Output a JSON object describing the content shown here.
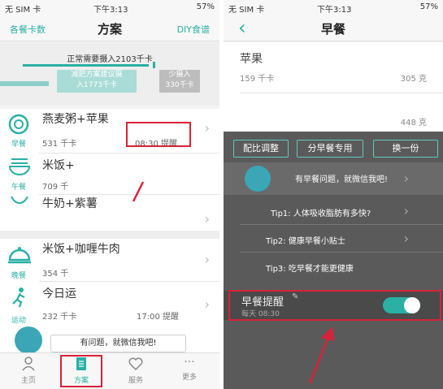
{
  "left": {
    "status": {
      "carrier": "无 SIM 卡",
      "time": "下午3:13",
      "battery": "57%"
    },
    "nav": {
      "left": "各餐卡数",
      "title": "方案",
      "right": "DIY食谱"
    },
    "intake": {
      "needed": "正常需要摄入2103千卡",
      "suggest_line1": "减肥方案建议摄",
      "suggest_line2": "入1773千卡",
      "less_line1": "少摄入",
      "less_line2": "330千卡"
    },
    "meals": [
      {
        "label": "早餐",
        "name": "燕麦粥+苹果",
        "kcal": "531 千卡",
        "reminder": "08:30 提醒"
      },
      {
        "label": "午餐",
        "name": "米饭+",
        "kcal": "709 千",
        "reminder": ""
      },
      {
        "label": "",
        "name": "牛奶+紫薯",
        "kcal": "",
        "reminder": ""
      },
      {
        "label": "晚餐",
        "name": "米饭+咖喱牛肉",
        "kcal": "354 千",
        "reminder": ""
      },
      {
        "label": "运动",
        "name": "今日运",
        "kcal": "232 千卡",
        "reminder": "17:00 提醒"
      }
    ],
    "chat_bubble": "有问题，就微信我吧!",
    "tabs": [
      {
        "label": "主页",
        "icon": "person-icon"
      },
      {
        "label": "方案",
        "icon": "document-icon"
      },
      {
        "label": "服务",
        "icon": "heart-icon"
      },
      {
        "label": "更多",
        "icon": "more-dots-icon"
      }
    ]
  },
  "right": {
    "status": {
      "carrier": "无 SIM 卡",
      "time": "下午3:13",
      "battery": "57%"
    },
    "nav": {
      "back": "‹",
      "title": "早餐"
    },
    "food": {
      "name": "苹果",
      "kcal": "159 千卡",
      "weight": "305 克",
      "weight2": "448 克"
    },
    "buttons": {
      "adjust": "配比调整",
      "share": "分早餐专用",
      "other": "换一份"
    },
    "chat": "有早餐问题，就微信我吧!",
    "tips": [
      "Tip1: 人体吸收脂肪有多快?",
      "Tip2: 健康早餐小贴士",
      "Tip3: 吃早餐才能更健康"
    ],
    "reminder": {
      "title": "早餐提醒",
      "time": "每天 08:30"
    }
  },
  "colors": {
    "accent": "#2ab0a4",
    "highlight": "#d9223a"
  }
}
